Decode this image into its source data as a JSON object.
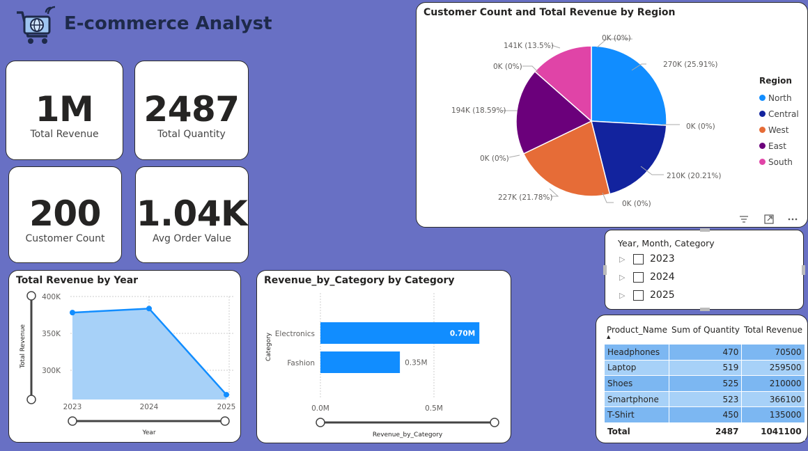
{
  "header": {
    "title": "E-commerce Analyst",
    "logo_icon": "shopping-cart-globe-icon"
  },
  "kpis": {
    "total_revenue": {
      "value": "1M",
      "label": "Total Revenue"
    },
    "total_quantity": {
      "value": "2487",
      "label": "Total Quantity"
    },
    "customer_count": {
      "value": "200",
      "label": "Customer Count"
    },
    "avg_order_value": {
      "value": "1.04K",
      "label": "Avg Order Value"
    }
  },
  "pie_chart": {
    "title": "Customer Count and Total Revenue by Region",
    "legend_title": "Region",
    "regions": [
      {
        "name": "North",
        "color": "#118dff"
      },
      {
        "name": "Central",
        "color": "#12239e"
      },
      {
        "name": "West",
        "color": "#e66c37"
      },
      {
        "name": "East",
        "color": "#6b007b"
      },
      {
        "name": "South",
        "color": "#e044a7"
      }
    ],
    "toolbar_icons": [
      "filter-icon",
      "focus-mode-icon",
      "more-options-icon"
    ]
  },
  "line_chart": {
    "title": "Total Revenue by Year",
    "xlabel": "Year",
    "ylabel": "Total Revenue",
    "y_ticks": [
      "400K",
      "350K",
      "300K"
    ],
    "x_ticks": [
      "2023",
      "2024",
      "2025"
    ]
  },
  "bar_chart": {
    "title": "Revenue_by_Category by Category",
    "xlabel": "Revenue_by_Category",
    "ylabel": "Category",
    "x_ticks": [
      "0.0M",
      "0.5M"
    ],
    "data_labels": [
      "0.70M",
      "0.35M"
    ]
  },
  "slicer": {
    "title": "Year, Month, Category",
    "items": [
      "2023",
      "2024",
      "2025"
    ]
  },
  "table": {
    "headers": [
      "Product_Name",
      "Sum of Quantity",
      "Total Revenue"
    ],
    "rows": [
      [
        "Headphones",
        "470",
        "70500"
      ],
      [
        "Laptop",
        "519",
        "259500"
      ],
      [
        "Shoes",
        "525",
        "210000"
      ],
      [
        "Smartphone",
        "523",
        "366100"
      ],
      [
        "T-Shirt",
        "450",
        "135000"
      ]
    ],
    "total": [
      "Total",
      "2487",
      "1041100"
    ]
  },
  "chart_data": [
    {
      "type": "pie",
      "title": "Customer Count and Total Revenue by Region",
      "legend_title": "Region",
      "legend_position": "right",
      "categories": [
        "North",
        "Central",
        "West",
        "East",
        "South"
      ],
      "values": [
        270,
        210,
        227,
        194,
        141
      ],
      "unit": "K",
      "data_labels": [
        "270K (25.91%)",
        "210K (20.21%)",
        "227K (21.78%)",
        "194K (18.59%)",
        "141K (13.5%)",
        "0K (0%)",
        "0K (0%)",
        "0K (0%)",
        "0K (0%)",
        "0K (0%)"
      ]
    },
    {
      "type": "area",
      "title": "Total Revenue by Year",
      "xlabel": "Year",
      "ylabel": "Total Revenue",
      "x": [
        "2023",
        "2024",
        "2025"
      ],
      "values": [
        380,
        385,
        278
      ],
      "unit": "K",
      "ylim": [
        272,
        400
      ],
      "grid": true
    },
    {
      "type": "bar",
      "orientation": "horizontal",
      "title": "Revenue_by_Category by Category",
      "xlabel": "Revenue_by_Category",
      "ylabel": "Category",
      "categories": [
        "Electronics",
        "Fashion"
      ],
      "values": [
        0.7,
        0.35
      ],
      "unit": "M",
      "xlim": [
        0,
        0.8
      ],
      "grid": true
    }
  ]
}
